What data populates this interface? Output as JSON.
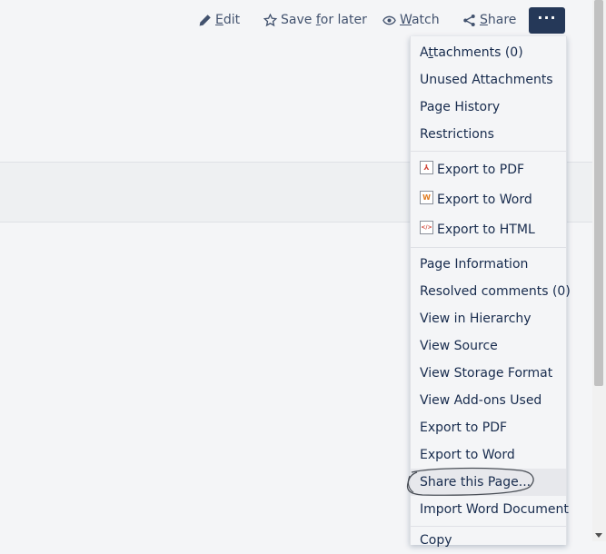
{
  "toolbar": {
    "edit": {
      "pre": "",
      "u": "E",
      "post": "dit"
    },
    "save": {
      "pre": "Save ",
      "u": "f",
      "post": "or later"
    },
    "watch": {
      "pre": "",
      "u": "W",
      "post": "atch"
    },
    "share": {
      "pre": "",
      "u": "S",
      "post": "hare"
    },
    "more_label": "···"
  },
  "menu": {
    "group1": {
      "attachments": {
        "pre": "A",
        "u": "t",
        "post": "tachments (0)"
      },
      "unused": "Unused Attachments",
      "history": "Page History",
      "restrictions": "Restrictions"
    },
    "group2": {
      "export_pdf": "Export to PDF",
      "export_word": "Export to Word",
      "export_html": "Export to HTML"
    },
    "group3": {
      "page_info": "Page Information",
      "resolved": "Resolved comments (0)",
      "hierarchy": "View in Hierarchy",
      "source": "View Source",
      "storage": "View Storage Format",
      "addons": "View Add-ons Used",
      "export_pdf": "Export to PDF",
      "export_word": "Export to Word",
      "share_page": "Share this Page...",
      "import_word": "Import Word Document"
    },
    "group4": {
      "copy": "Copy"
    }
  },
  "icons": {
    "pdf": "pdf-file-icon",
    "word": "word-file-icon",
    "html": "html-file-icon",
    "pdf_glyph": "⅄",
    "word_glyph": "W",
    "html_glyph": "</>"
  }
}
